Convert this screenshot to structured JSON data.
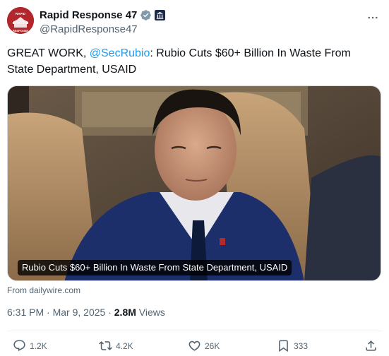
{
  "author": {
    "display_name": "Rapid Response 47",
    "handle": "@RapidResponse47",
    "avatar_text": "RAPID RESPONSE",
    "verified_icon": "verified-badge-icon",
    "affiliation_icon": "government-building-icon",
    "avatar_color": "#b3262c"
  },
  "tweet": {
    "text_prefix": "GREAT WORK, ",
    "mention": "@SecRubio",
    "text_suffix": ": Rubio Cuts $60+ Billion In Waste From State Department, USAID"
  },
  "media": {
    "caption": "Rubio Cuts $60+ Billion In Waste From State Department, USAID",
    "source": "From dailywire.com"
  },
  "meta": {
    "time": "6:31 PM",
    "sep1": " · ",
    "date": "Mar 9, 2025",
    "sep2": " · ",
    "views_count": "2.8M",
    "views_label": " Views"
  },
  "actions": {
    "replies": "1.2K",
    "reposts": "4.2K",
    "likes": "26K",
    "bookmarks": "333"
  },
  "colors": {
    "link": "#1d9bf0",
    "muted": "#536471",
    "verified": "#829aab"
  }
}
